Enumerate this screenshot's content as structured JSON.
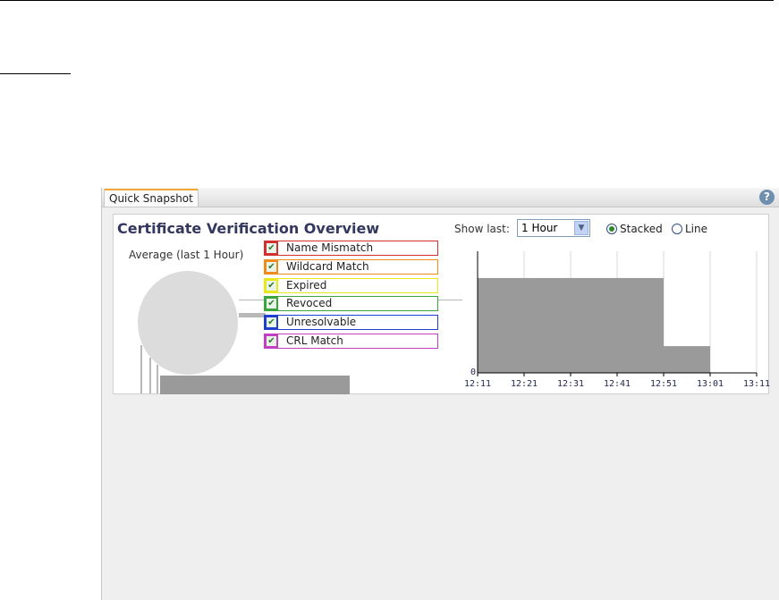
{
  "panel": {
    "tab_label": "Quick Snapshot",
    "help_icon": "help-icon",
    "help_glyph": "?"
  },
  "overview": {
    "title": "Certificate Verification Overview",
    "average_label": "Average (last 1 Hour)"
  },
  "legend": {
    "items": [
      {
        "label": "Name Mismatch",
        "color": "#d32f2f",
        "checked": true
      },
      {
        "label": "Wildcard Match",
        "color": "#f08a1c",
        "checked": true
      },
      {
        "label": "Expired",
        "color": "#e8e81a",
        "checked": true
      },
      {
        "label": "Revoced",
        "color": "#3aa53a",
        "checked": true
      },
      {
        "label": "Unresolvable",
        "color": "#1f3fd0",
        "checked": true
      },
      {
        "label": "CRL Match",
        "color": "#c23fc2",
        "checked": true
      }
    ]
  },
  "controls": {
    "show_last_label": "Show last:",
    "show_last_value": "1 Hour",
    "radio_stacked_label": "Stacked",
    "radio_line_label": "Line",
    "selected_mode": "Stacked"
  },
  "chart_data": {
    "type": "area",
    "x": [
      "12:11",
      "12:21",
      "12:31",
      "12:41",
      "12:51",
      "13:01",
      "13:11"
    ],
    "y_tick_labels": [
      "0"
    ],
    "series": [
      {
        "values": [
          0.78,
          0.78,
          0.78,
          0.78,
          0.22,
          0.0,
          0.0
        ]
      }
    ],
    "grid": true,
    "fill_color": "#9a9a9a"
  }
}
